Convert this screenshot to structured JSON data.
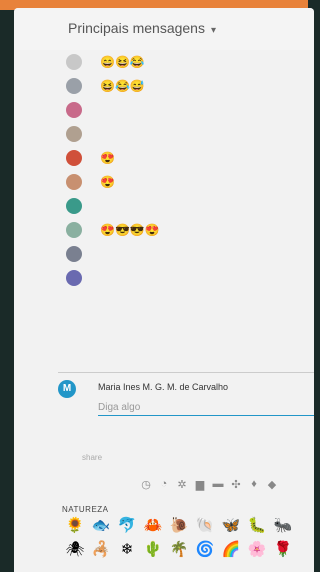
{
  "header": {
    "title": "Principais mensagens",
    "caret": "▾"
  },
  "messages": [
    {
      "name": "",
      "text": "",
      "emojis": "😄😆😂",
      "avatar": "#c8c8c8"
    },
    {
      "name": "",
      "text": "",
      "emojis": "😆😂😅",
      "avatar": "#9aa0a8"
    },
    {
      "name": "",
      "text": "",
      "emojis": "",
      "avatar": "#c86a8a"
    },
    {
      "name": "",
      "text": "",
      "emojis": "",
      "avatar": "#b0a090"
    },
    {
      "name": "",
      "text": "",
      "emojis": "😍",
      "avatar": "#d0503a"
    },
    {
      "name": "",
      "text": "",
      "emojis": "😍",
      "avatar": "#c89070"
    },
    {
      "name": "",
      "text": "",
      "emojis": "",
      "avatar": "#3a9a8a"
    },
    {
      "name": "",
      "text": "",
      "emojis": "😍😎😎😍",
      "avatar": "#8ab0a0"
    },
    {
      "name": "",
      "text": "",
      "emojis": "",
      "avatar": "#7a8090"
    },
    {
      "name": "",
      "text": "",
      "emojis": "",
      "avatar": "#6a6ab0"
    }
  ],
  "compose": {
    "initial": "M",
    "author": "Maria Ines M. G. M. de Carvalho",
    "placeholder": "Diga algo"
  },
  "share_label": "share",
  "toolbar_icons": [
    "◷",
    "◔",
    "✲",
    "▆",
    "▬",
    "✣",
    "♦",
    "◆"
  ],
  "section_label": "NATUREZA",
  "emoji_grid": [
    "🌻",
    "🐟",
    "🐬",
    "🦀",
    "🐌",
    "🐚",
    "🦋",
    "🐛",
    "🐜",
    "🕷",
    "🦂",
    "❄",
    "🌵",
    "🌴",
    "🌀",
    "🌈",
    "🌸",
    "🌹"
  ]
}
